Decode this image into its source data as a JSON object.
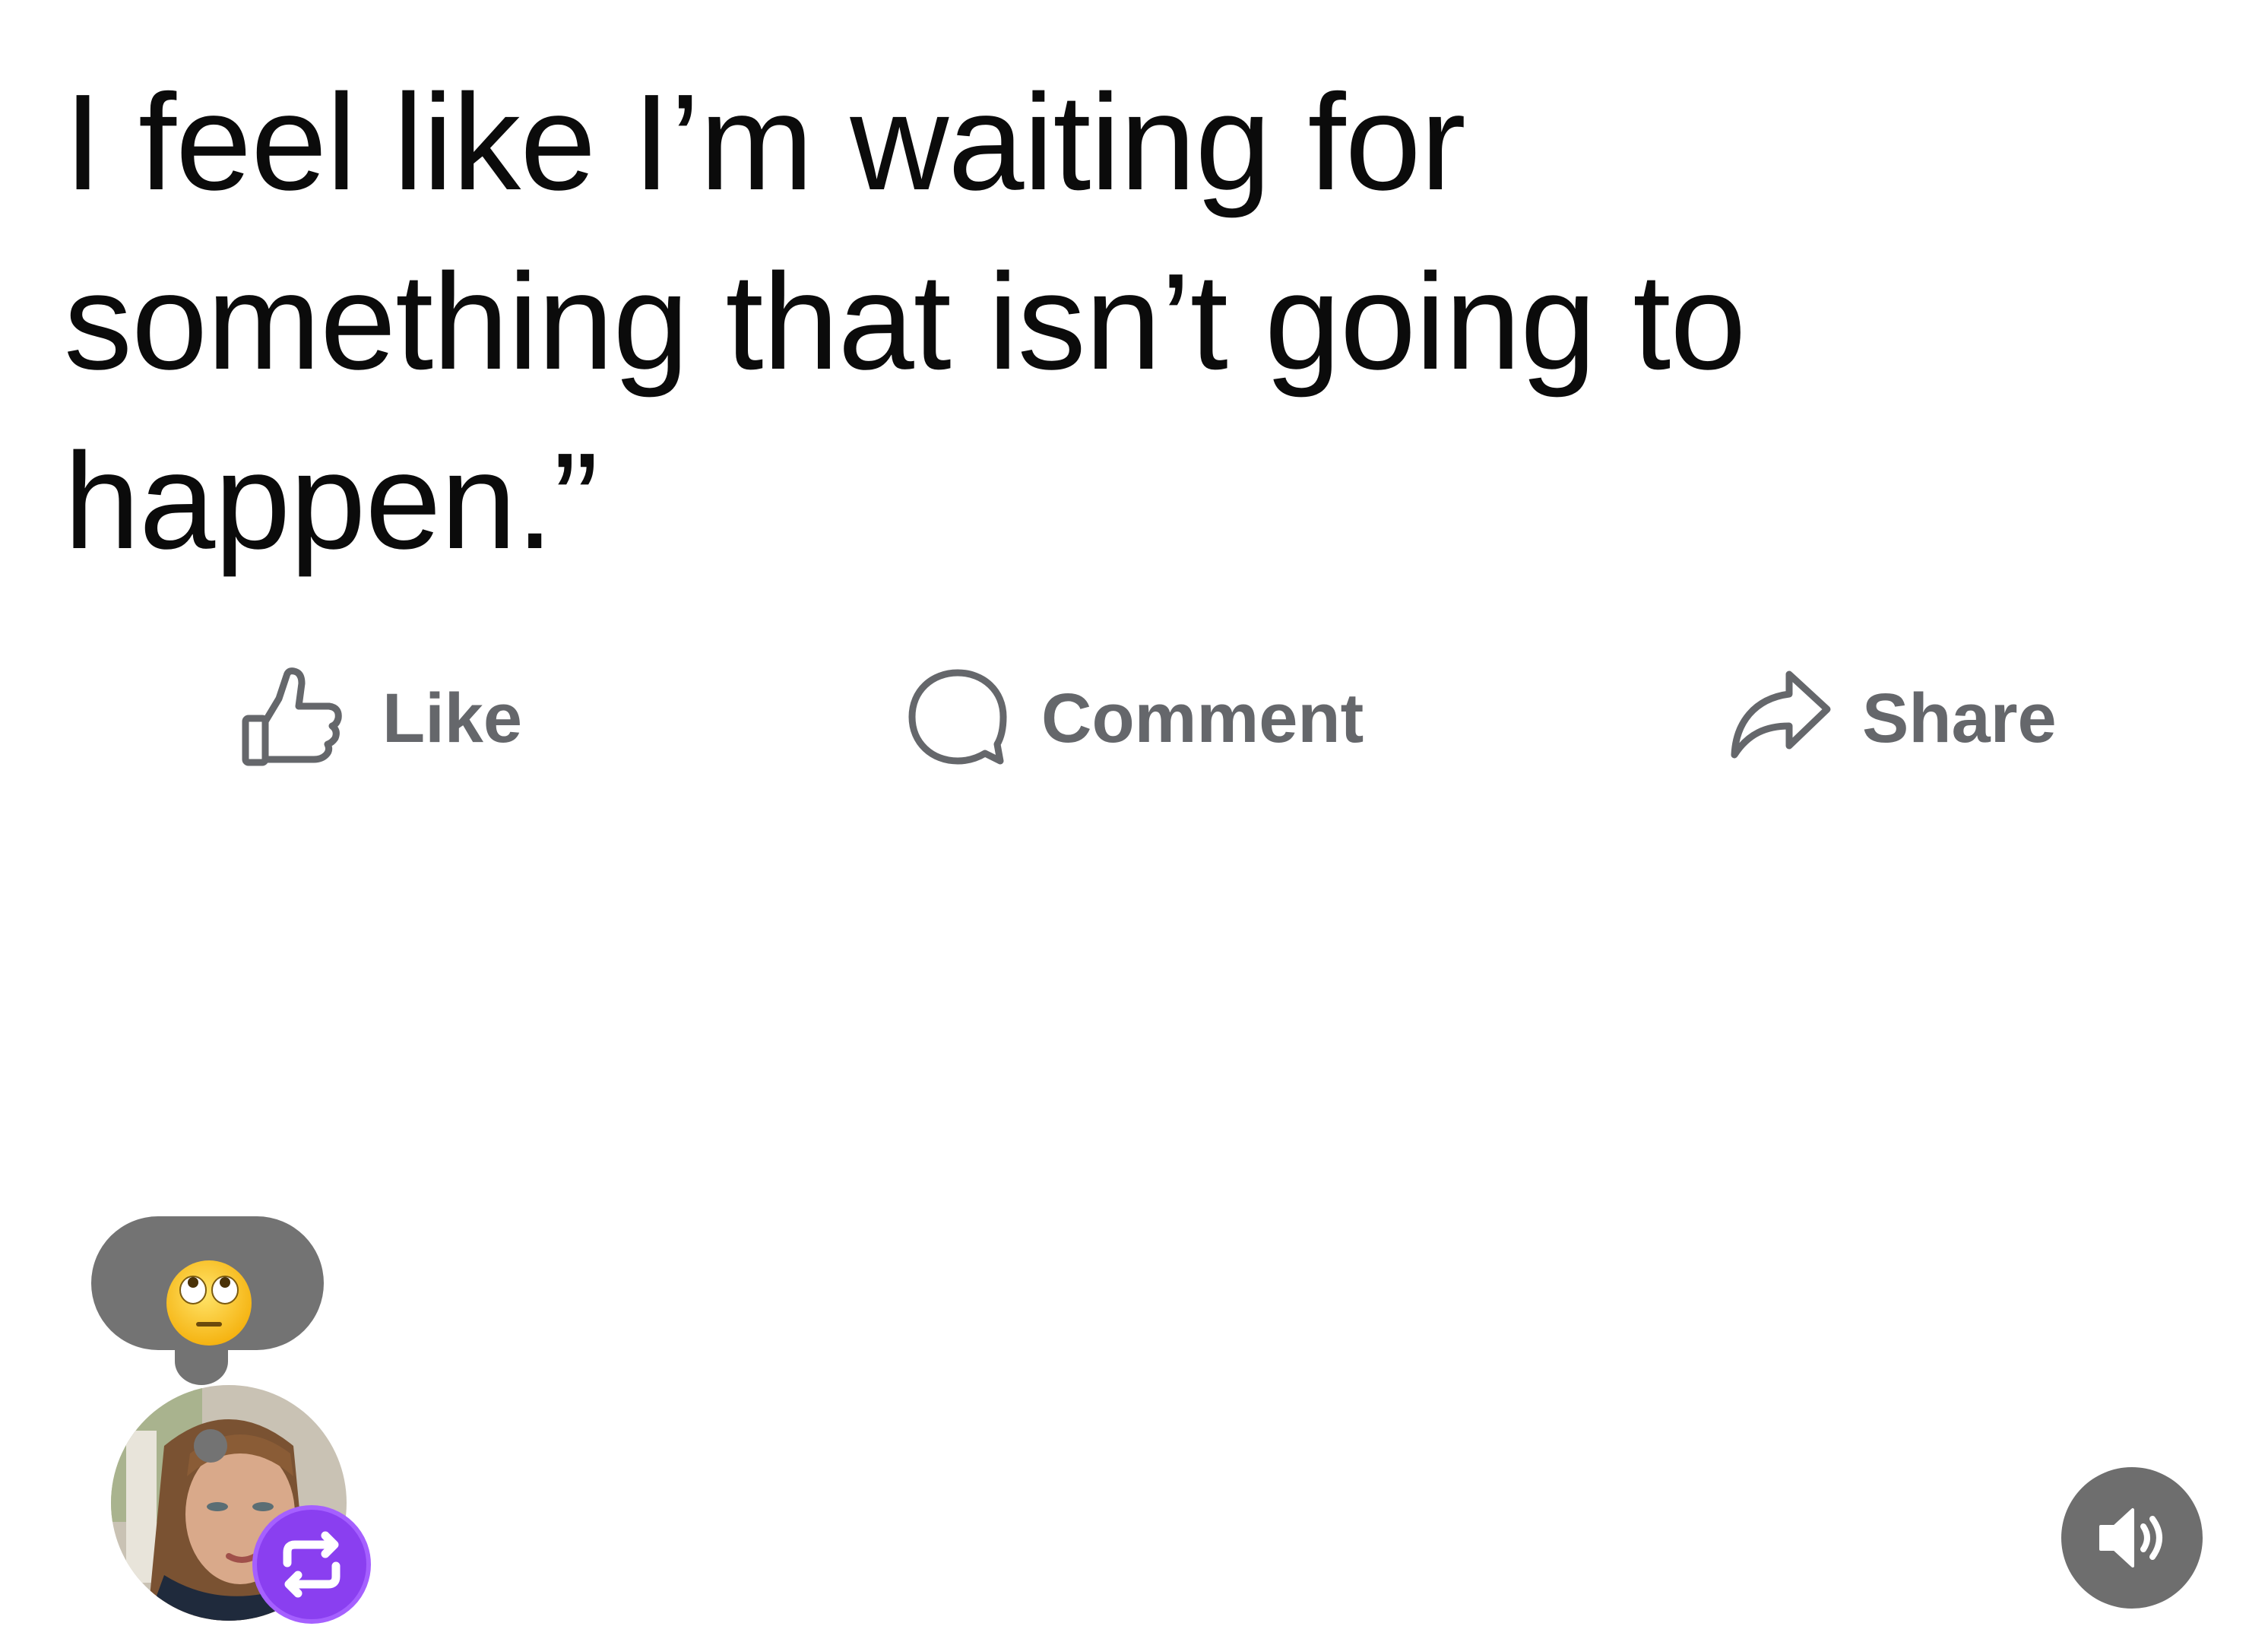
{
  "post": {
    "text": "I feel like I’m waiting for something that isn’t going to happen.”"
  },
  "actions": {
    "like_label": "Like",
    "comment_label": "Comment",
    "share_label": "Share"
  },
  "reaction": {
    "emoji": "🙄",
    "emoji_name": "face-with-rolling-eyes"
  },
  "icons": {
    "like": "thumbs-up-outline-icon",
    "comment": "speech-bubble-outline-icon",
    "share": "share-arrow-outline-icon",
    "repost": "repost-icon",
    "sound": "speaker-volume-icon"
  },
  "colors": {
    "text": "#0b0b0b",
    "action_text": "#65676b",
    "bubble": "#737373",
    "repost_badge": "#8a3ff0",
    "sound_button": "#6e6e6e"
  }
}
